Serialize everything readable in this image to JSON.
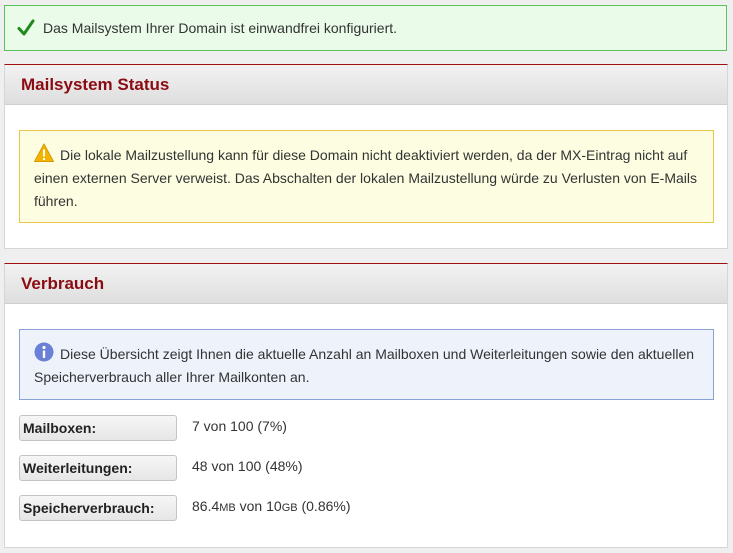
{
  "success_message": "Das Mailsystem Ihrer Domain ist einwandfrei konfiguriert.",
  "status_panel": {
    "title": "Mailsystem Status",
    "warning": "Die lokale Mailzustellung kann für diese Domain nicht deaktiviert werden, da der MX-Eintrag nicht auf einen externen Server verweist. Das Abschalten der lokalen Mailzustellung würde zu Verlusten von E-Mails führen."
  },
  "usage_panel": {
    "title": "Verbrauch",
    "info": "Diese Übersicht zeigt Ihnen die aktuelle Anzahl an Mailboxen und Weiterleitungen sowie den aktuellen Speicherverbrauch aller Ihrer Mailkonten an.",
    "rows": [
      {
        "label": "Mailboxen:",
        "value": "7 von 100 (7%)"
      },
      {
        "label": "Weiterleitungen:",
        "value": "48 von 100 (48%)"
      },
      {
        "label": "Speicherverbrauch:",
        "value_a": "86.4",
        "unit_a": "MB",
        "value_b": " von 10",
        "unit_b": "GB",
        "value_c": " (0.86%)"
      }
    ]
  },
  "colors": {
    "accent": "#8a0c12",
    "success_border": "#5cc15c",
    "warning_border": "#e7c84a",
    "info_border": "#8aa3d6"
  },
  "icons": {
    "success": "check-icon",
    "warning": "warning-triangle-icon",
    "info": "info-circle-icon"
  }
}
